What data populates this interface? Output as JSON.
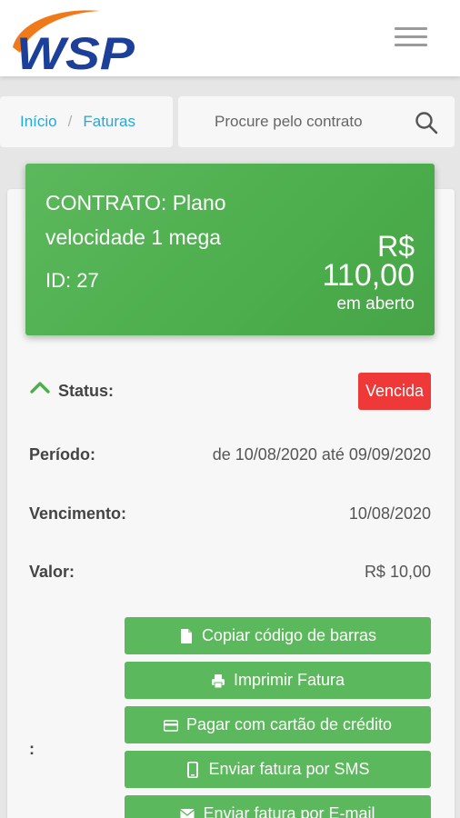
{
  "header": {
    "logo_text": "WSP",
    "menu_icon": "hamburger-menu-icon"
  },
  "breadcrumb": {
    "home_label": "Início",
    "separator": "/",
    "current_label": "Faturas"
  },
  "search": {
    "placeholder": "Procure pelo contrato",
    "value": "",
    "icon": "search-icon"
  },
  "contract": {
    "title": "CONTRATO: Plano velocidade 1 mega",
    "id_label": "ID: 27",
    "currency": "R$",
    "amount": "110,00",
    "amount_status": "em aberto"
  },
  "invoice": {
    "status_label": "Status:",
    "status_value": "Vencida",
    "period_label": "Período:",
    "period_value": "de 10/08/2020 até 09/09/2020",
    "due_label": "Vencimento:",
    "due_value": "10/08/2020",
    "value_label": "Valor:",
    "value_value": "R$ 10,00",
    "actions_label": ":"
  },
  "actions": [
    {
      "label": "Copiar código de barras",
      "icon": "file-icon"
    },
    {
      "label": "Imprimir Fatura",
      "icon": "printer-icon"
    },
    {
      "label": "Pagar com cartão de crédito",
      "icon": "credit-card-icon"
    },
    {
      "label": "Enviar fatura por SMS",
      "icon": "mobile-phone-icon"
    },
    {
      "label": "Enviar fatura por E-mail",
      "icon": "envelope-icon"
    }
  ],
  "colors": {
    "primary_green": "#5cb85c",
    "danger_red": "#ef3838",
    "link_blue": "#29a7d6",
    "logo_blue": "#1c3f9a",
    "logo_orange": "#f07a1a"
  }
}
